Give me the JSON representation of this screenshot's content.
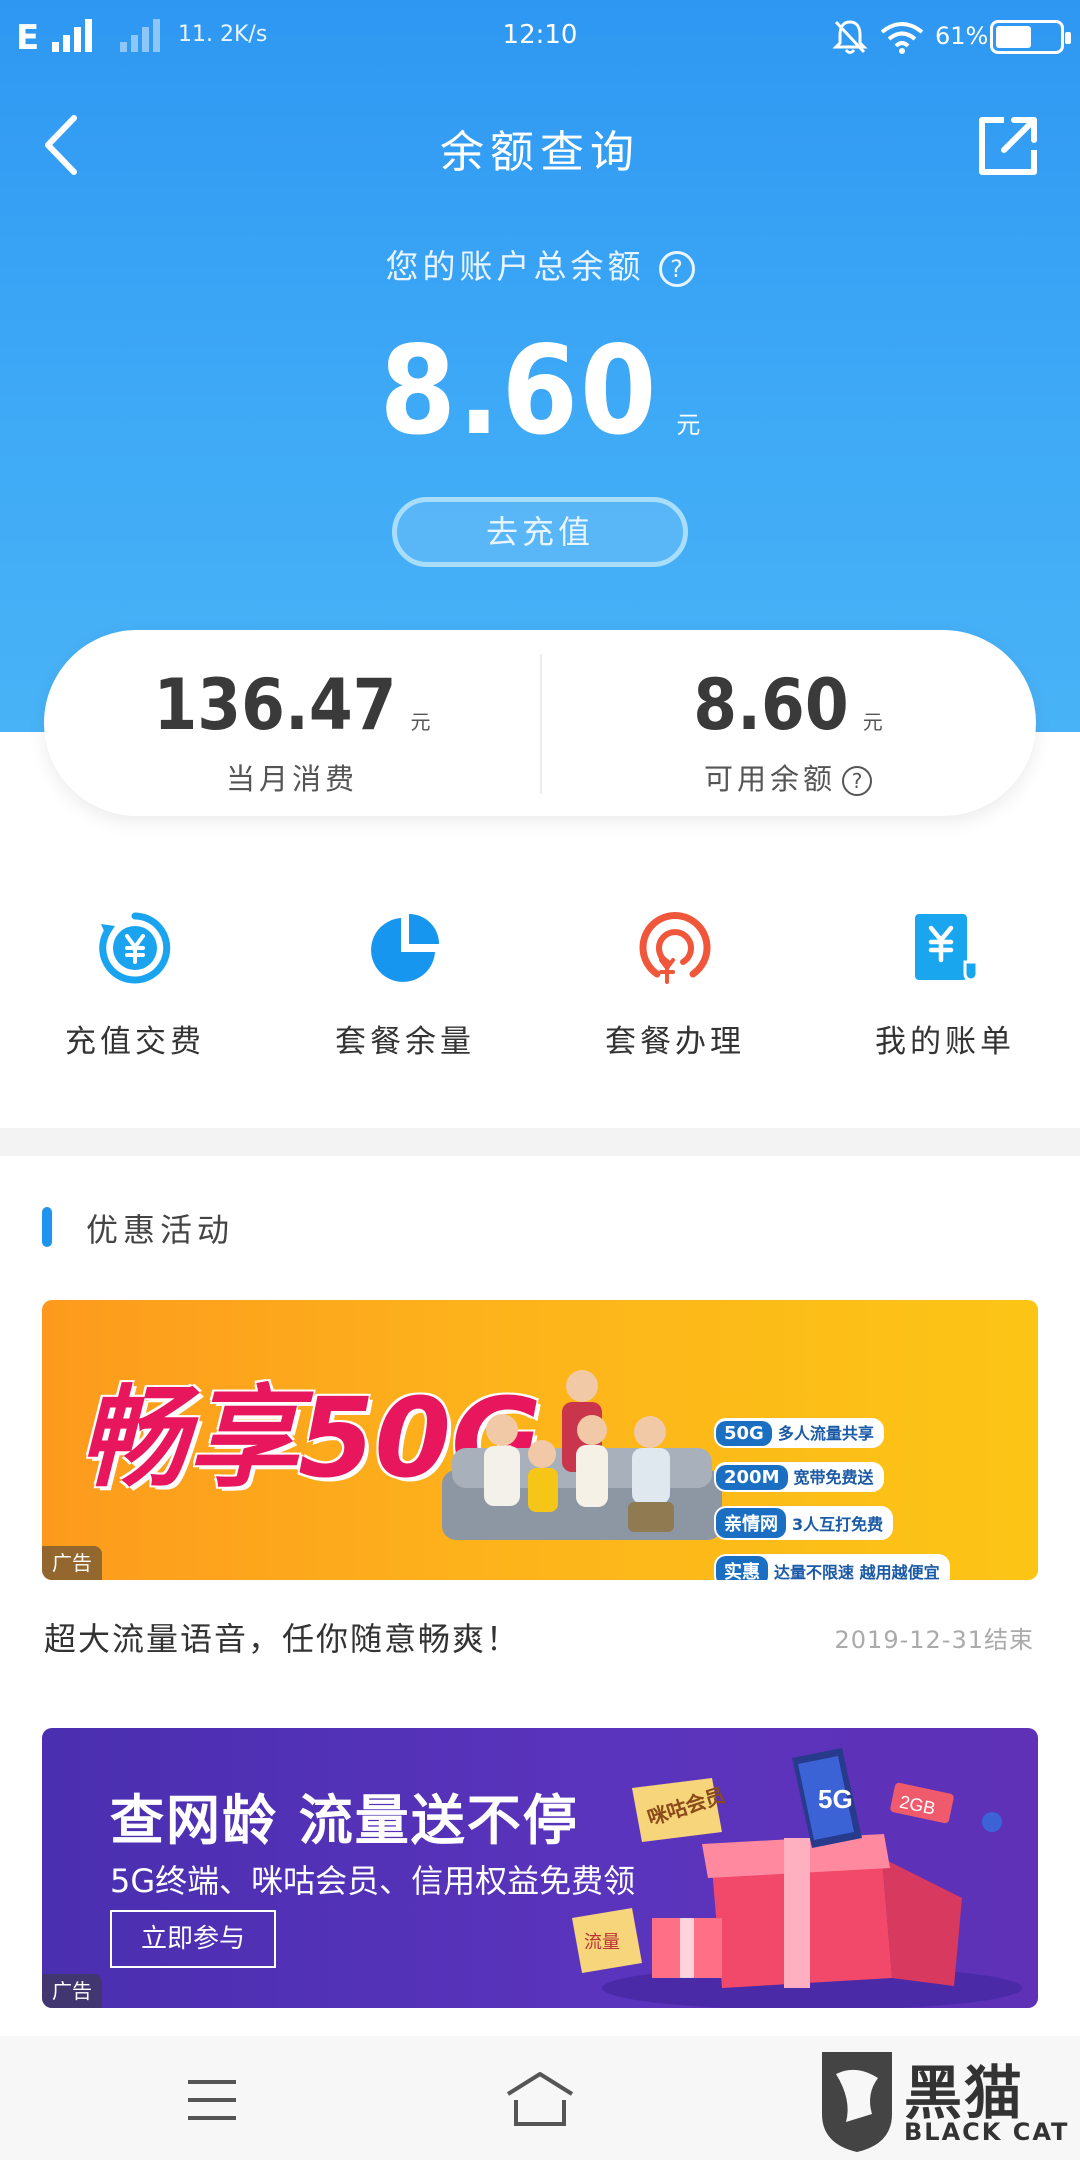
{
  "status_bar": {
    "carrier": "E",
    "speed": "11. 2K/s",
    "time": "12:10",
    "battery": "61%",
    "battery_level": 0.61
  },
  "header": {
    "title": "余额查询",
    "icons": [
      "back-arrow-icon",
      "share-icon"
    ]
  },
  "balance": {
    "label": "您的账户总余额",
    "help_icon": "?",
    "amount": "8.60",
    "unit": "元",
    "recharge_label": "去充值"
  },
  "summary": {
    "monthly": {
      "value": "136.47",
      "unit": "元",
      "label": "当月消费"
    },
    "available": {
      "value": "8.60",
      "unit": "元",
      "label": "可用余额",
      "help_icon": "?"
    }
  },
  "actions": [
    {
      "label": "充值交费",
      "icon": "recharge-yuan-icon",
      "color": "#1aa3ef"
    },
    {
      "label": "套餐余量",
      "icon": "pie-chart-icon",
      "color": "#1796f0"
    },
    {
      "label": "套餐办理",
      "icon": "package-yuan-icon",
      "color": "#f0573a"
    },
    {
      "label": "我的账单",
      "icon": "bill-yuan-icon",
      "color": "#1aa6ef"
    }
  ],
  "promotions": {
    "section_title": "优惠活动",
    "items": [
      {
        "banner_title": "畅享50G",
        "tags": [
          {
            "key": "50G",
            "text": "多人流量共享"
          },
          {
            "key": "200M",
            "text": "宽带免费送"
          },
          {
            "key": "亲情网",
            "text": "3人互打免费"
          },
          {
            "key": "实惠",
            "text": "达量不限速 越用越便宜"
          }
        ],
        "ad_label": "广告",
        "description": "超大流量语音，任你随意畅爽！",
        "end_date": "2019-12-31结束"
      },
      {
        "banner_title": "查网龄 流量送不停",
        "banner_subtitle": "5G终端、咪咕会员、信用权益免费领",
        "button_label": "立即参与",
        "gift_labels": [
          "咪咕会员",
          "5G",
          "2GB",
          "流量"
        ],
        "ad_label": "广告"
      }
    ]
  },
  "bottom_nav": {
    "icons": [
      "menu-icon",
      "home-icon"
    ]
  },
  "watermark": {
    "text": "黑猫",
    "sub": "BLACK CAT"
  },
  "colors": {
    "header_blue": "#2e97f2",
    "accent": "#1e94ee",
    "promo_pink": "#e8175d"
  }
}
